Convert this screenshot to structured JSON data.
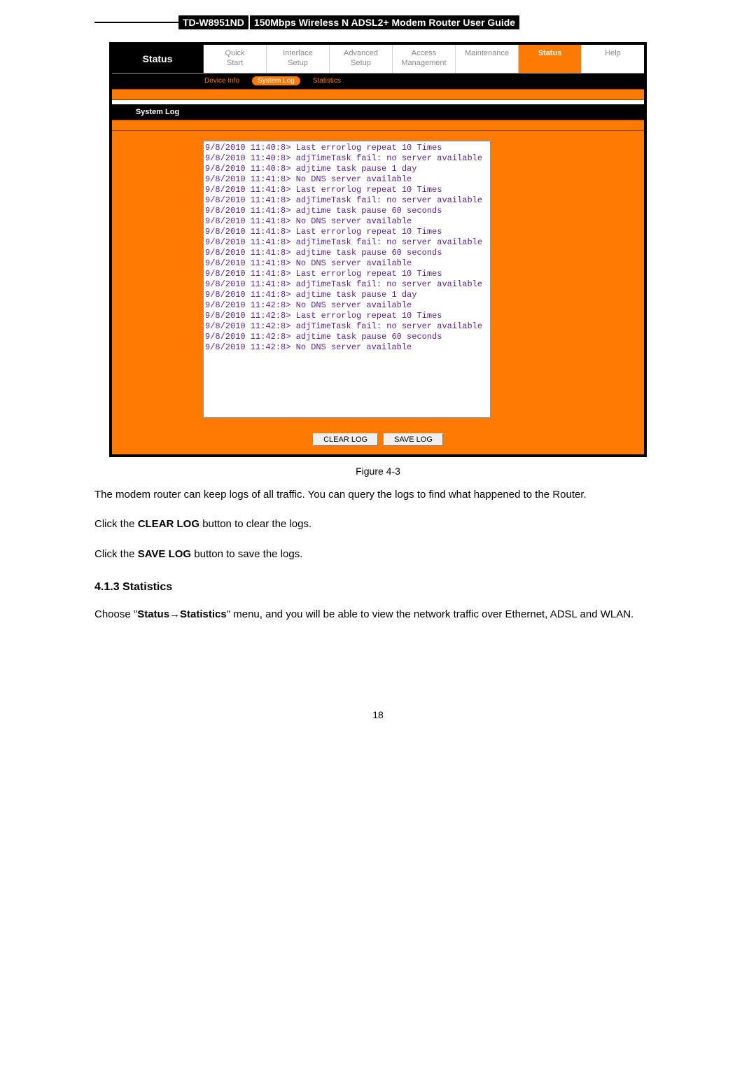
{
  "header": {
    "model": "TD-W8951ND",
    "title": "150Mbps Wireless N ADSL2+ Modem Router User Guide"
  },
  "router": {
    "side_label": "Status",
    "nav": [
      {
        "ln1": "Quick",
        "ln2": "Start"
      },
      {
        "ln1": "Interface",
        "ln2": "Setup"
      },
      {
        "ln1": "Advanced",
        "ln2": "Setup"
      },
      {
        "ln1": "Access",
        "ln2": "Management"
      },
      {
        "ln1": "Maintenance",
        "ln2": ""
      },
      {
        "ln1": "Status",
        "ln2": ""
      },
      {
        "ln1": "Help",
        "ln2": ""
      }
    ],
    "subnav": {
      "items": [
        "Device Info",
        "System Log",
        "Statistics"
      ],
      "active_index": 1
    },
    "section_label": "System Log",
    "log_text": "9/8/2010 11:40:8> Last errorlog repeat 10 Times\n9/8/2010 11:40:8> adjTimeTask fail: no server available\n9/8/2010 11:40:8> adjtime task pause 1 day\n9/8/2010 11:41:8> No DNS server available\n9/8/2010 11:41:8> Last errorlog repeat 10 Times\n9/8/2010 11:41:8> adjTimeTask fail: no server available\n9/8/2010 11:41:8> adjtime task pause 60 seconds\n9/8/2010 11:41:8> No DNS server available\n9/8/2010 11:41:8> Last errorlog repeat 10 Times\n9/8/2010 11:41:8> adjTimeTask fail: no server available\n9/8/2010 11:41:8> adjtime task pause 60 seconds\n9/8/2010 11:41:8> No DNS server available\n9/8/2010 11:41:8> Last errorlog repeat 10 Times\n9/8/2010 11:41:8> adjTimeTask fail: no server available\n9/8/2010 11:41:8> adjtime task pause 1 day\n9/8/2010 11:42:8> No DNS server available\n9/8/2010 11:42:8> Last errorlog repeat 10 Times\n9/8/2010 11:42:8> adjTimeTask fail: no server available\n9/8/2010 11:42:8> adjtime task pause 60 seconds\n9/8/2010 11:42:8> No DNS server available",
    "buttons": {
      "clear": "CLEAR LOG",
      "save": "SAVE LOG"
    }
  },
  "figure_caption": "Figure 4-3",
  "text": {
    "p1_a": "The modem router can keep logs of all traffic. You can query the logs to find what happened to the",
    "p1_b": "Router.",
    "p2_a": "Click the ",
    "p2_b": "CLEAR LOG",
    "p2_c": " button to clear the logs.",
    "p3_a": "Click the ",
    "p3_b": "SAVE LOG",
    "p3_c": " button to save the logs.",
    "h4": "4.1.3  Statistics",
    "p4_a": "Choose \"",
    "p4_b": "Status",
    "p4_c": "Statistics",
    "p4_d": "\" menu, and you will be able to view the network traffic over Ethernet,",
    "p4_e": "ADSL and WLAN."
  },
  "page_number": "18"
}
